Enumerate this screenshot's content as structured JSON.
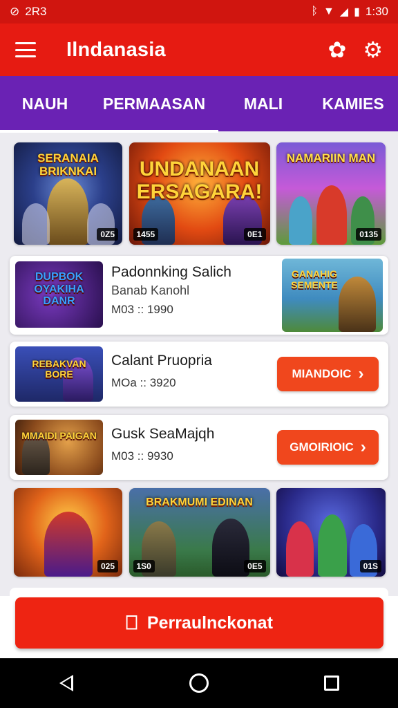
{
  "status_bar": {
    "left_icon": "circle-record-icon",
    "left_text": "2R3",
    "bluetooth_glyph": "ᛒ",
    "wifi_glyph": "▼",
    "signal_glyph": "◢",
    "battery_glyph": "▮",
    "time": "1:30"
  },
  "app_bar": {
    "title": "Ilndanasia",
    "icon_1": "gear-outline-icon",
    "icon_2": "settings-gear-icon",
    "bg_color": "#e61b12"
  },
  "tabs": [
    {
      "label": "NAUH"
    },
    {
      "label": "PERMAASAN"
    },
    {
      "label": "MALI"
    },
    {
      "label": "KAMIES"
    }
  ],
  "tab_bar_color": "#6a22b4",
  "tile_row_1": [
    {
      "title": "SERANAIA BRIKNKAI",
      "badge": "0Z5"
    },
    {
      "title": "UNDANAAN ERSAGARA!",
      "badge": "1455",
      "badge2": "0E1"
    },
    {
      "title": "NAMARIIN MAN",
      "badge": "0135"
    }
  ],
  "cards": [
    {
      "thumb_text": "DUPBOK OYAKIHA DANR",
      "title": "Padonnking Salich",
      "subtitle": "Banab Kanohl",
      "meta": "M03 :: 1990",
      "side_text": "GANAHIG SEMENTE"
    },
    {
      "thumb_text": "REBAKVAN BORE",
      "title": "Calant Pruopria",
      "meta": "MOa :: 3920",
      "button": "MIANDOIC"
    },
    {
      "thumb_text": "MMAIDI PAIGAN",
      "title": "Gusk SeaMajqh",
      "meta": "M03 :: 9930",
      "button": "GMOIRIOIC"
    }
  ],
  "tile_row_2": [
    {
      "title": "",
      "badge": "025"
    },
    {
      "title": "BRAKMUMI EDINAN",
      "badge": "1S0",
      "badge2": "0E5"
    },
    {
      "title": "",
      "badge": "01S"
    }
  ],
  "cta": {
    "label": "Perraulnckonat",
    "icon": "bookmark-icon",
    "color": "#ee2412"
  },
  "nav": {
    "back": "back-triangle-icon",
    "home": "home-circle-icon",
    "recent": "recent-square-icon"
  }
}
